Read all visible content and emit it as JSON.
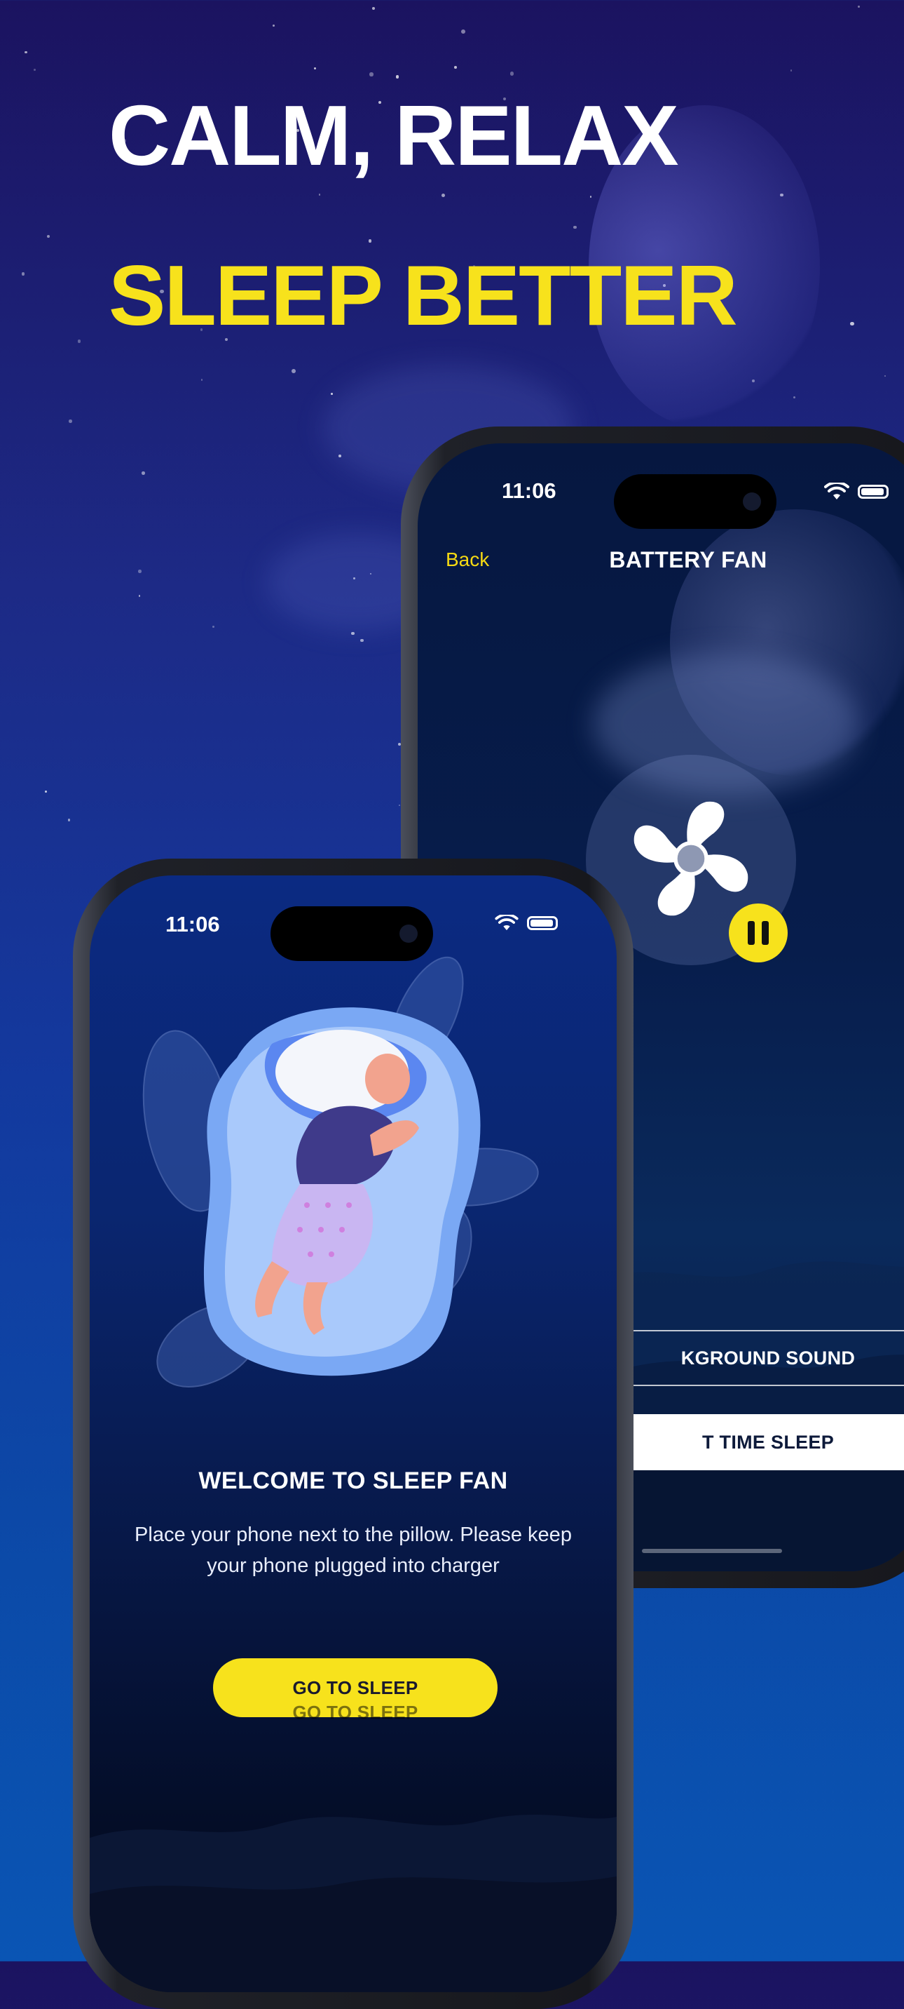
{
  "headline": {
    "line1": "CALM, RELAX",
    "line2": "SLEEP BETTER",
    "line1_color": "#ffffff",
    "line2_color": "#f7e21c"
  },
  "back_phone": {
    "status_time": "11:06",
    "back_label": "Back",
    "title": "BATTERY FAN",
    "fan_icon": "fan-icon",
    "pause_icon": "pause-icon",
    "background_sound_label": "KGROUND SOUND",
    "time_sleep_label": "T TIME SLEEP"
  },
  "front_phone": {
    "status_time": "11:06",
    "illustration": "sleeping-woman-illustration",
    "welcome_title": "WELCOME TO SLEEP FAN",
    "welcome_text": "Place your phone next to the pillow. Please keep your phone plugged into charger",
    "go_button": "GO TO SLEEP"
  },
  "colors": {
    "accent_yellow": "#f7e21c",
    "background_top": "#1b1360",
    "background_bottom": "#0a55b4"
  }
}
